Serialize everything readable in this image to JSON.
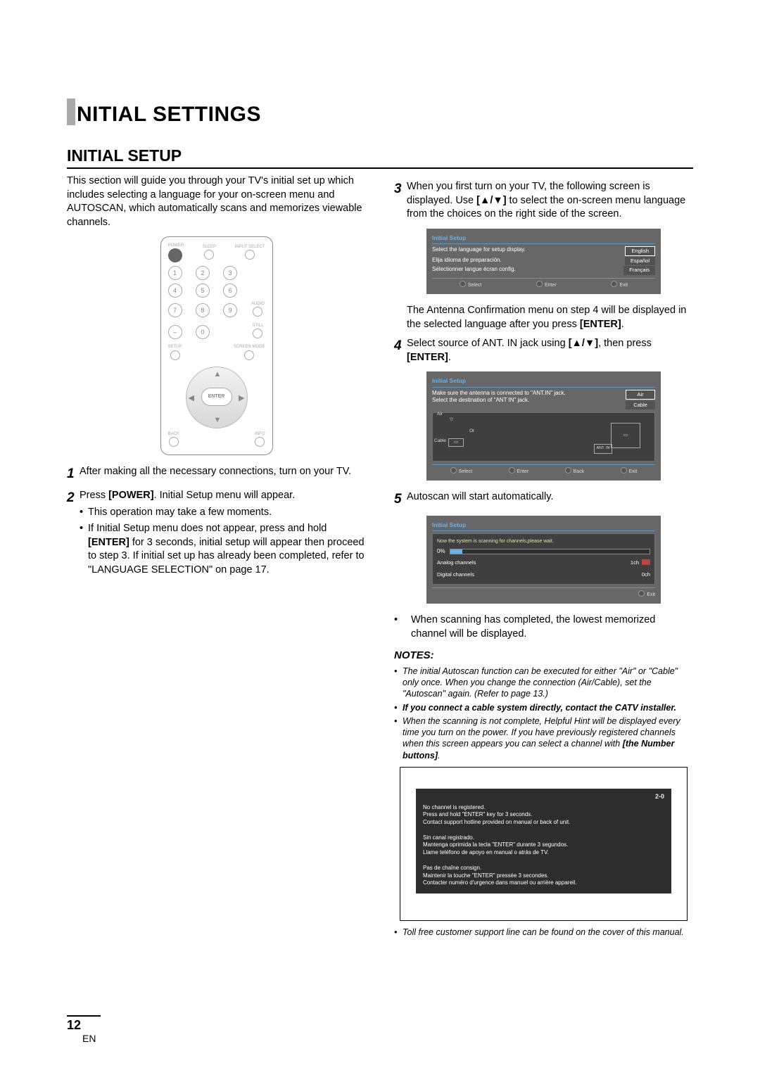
{
  "title_main": "NITIAL SETTINGS",
  "section_title": "INITIAL SETUP",
  "intro": "This section will guide you through your TV's initial set up which includes selecting a language for your on-screen menu and AUTOSCAN, which automatically scans and memorizes viewable channels.",
  "remote": {
    "power": "POWER",
    "sleep": "SLEEP",
    "input_select": "INPUT SELECT",
    "audio": "AUDIO",
    "still": "STILL",
    "setup": "SETUP",
    "screen_mode": "SCREEN MODE",
    "back": "BACK",
    "info": "INFO",
    "enter": "ENTER",
    "keys": [
      "1",
      "2",
      "3",
      "4",
      "5",
      "6",
      "7",
      "8",
      "9",
      "–",
      "0"
    ]
  },
  "steps": {
    "s1": "After making all the necessary connections, turn on your TV.",
    "s2_pre": "Press ",
    "s2_strong": "[POWER]",
    "s2_post": ". Initial Setup menu will appear.",
    "s2_b1": "This operation may take a few moments.",
    "s2_b2_pre": "If Initial Setup menu does not appear, press and hold ",
    "s2_b2_strong": "[ENTER]",
    "s2_b2_post": " for 3 seconds, initial setup will appear then proceed to step 3. If initial set up has already been completed, refer to \"LANGUAGE SELECTION\" on page 17.",
    "s3_pre": "When you first turn on your TV, the following screen is displayed. Use ",
    "s3_keys": "[▲/▼]",
    "s3_post": " to select the on-screen menu language from the choices on the right side of the screen.",
    "s3_after_pre": "The Antenna Confirmation menu on step 4 will be displayed in the selected language after you press ",
    "s3_after_strong": "[ENTER]",
    "s3_after_post": ".",
    "s4_pre": "Select source of ANT. IN jack using ",
    "s4_keys": "[▲/▼]",
    "s4_mid": ", then press ",
    "s4_strong": "[ENTER]",
    "s4_post": ".",
    "s5": "Autoscan will start automatically.",
    "s5_b1": "When scanning has completed, the lowest memorized channel will be displayed."
  },
  "osd_lang": {
    "title": "Initial Setup",
    "en_label": "Select the language for setup display.",
    "es_label": "Elija idioma de preparación.",
    "fr_label": "Sélectionner langue écran config.",
    "en_opt": "English",
    "es_opt": "Español",
    "fr_opt": "Français",
    "select": "Select",
    "enter": "Enter",
    "exit": "Exit"
  },
  "osd_ant": {
    "title": "Initial Setup",
    "msg1": "Make sure the antenna is connected to \"ANT.IN\" jack.",
    "msg2": "Select the destination of \"ANT IN\" jack.",
    "air": "Air",
    "cable": "Cable",
    "or": "Or",
    "antin": "ANT. IN",
    "select": "Select",
    "enter": "Enter",
    "back": "Back",
    "exit": "Exit"
  },
  "osd_scan": {
    "title": "Initial Setup",
    "msg": "Now the system is scanning for channels,please wait.",
    "pct": "0%",
    "analog_l": "Analog channels",
    "analog_v": "1ch",
    "digital_l": "Digital channels",
    "digital_v": "0ch",
    "exit": "Exit"
  },
  "notes_heading": "NOTES:",
  "notes": {
    "n1": "The initial Autoscan function can be executed for either \"Air\" or \"Cable\" only once. When you change the connection (Air/Cable), set the \"Autoscan\" again. (Refer to page 13.)",
    "n2": "If you connect a cable system directly, contact the CATV installer.",
    "n3_pre": "When the scanning is not complete, Helpful Hint will be displayed every time you turn on the power. If you have previously registered channels when this screen appears you can select a channel with ",
    "n3_strong": "[the Number buttons]",
    "n3_post": ".",
    "n4": "Toll free customer support line can be found on the cover of this manual."
  },
  "hint": {
    "ch": "2-0",
    "en1": "No channel is registered.",
    "en2": "Press and hold \"ENTER\" key for 3 seconds.",
    "en3": "Contact support hotline provided on manual or back of unit.",
    "es1": "Sin canal registrado.",
    "es2": "Mantenga oprimida la tecla \"ENTER\" durante 3 segundos.",
    "es3": "Llame teléfono de apoyo en manual o atrás de TV.",
    "fr1": "Pas de chaîne consign.",
    "fr2": "Maintenir la touche \"ENTER\" pressée 3 secondes.",
    "fr3": "Contacter numéro d'urgence dans manuel ou arrière appareil."
  },
  "page_number": "12",
  "page_lang": "EN"
}
